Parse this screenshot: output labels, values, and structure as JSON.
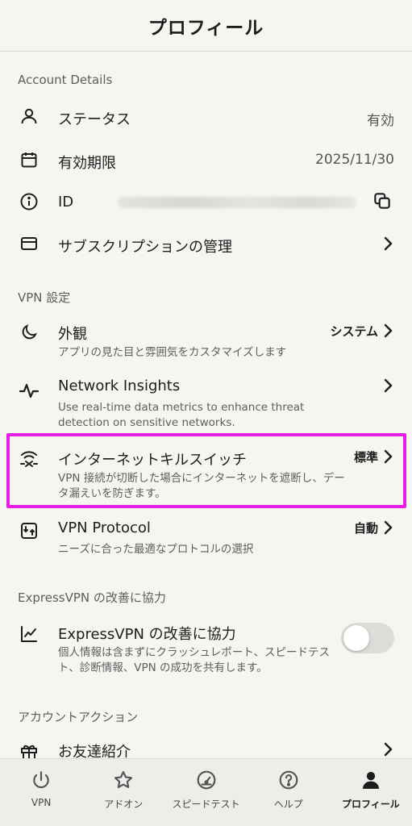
{
  "header": {
    "title": "プロフィール"
  },
  "account": {
    "section_title": "Account Details",
    "status_label": "ステータス",
    "status_value": "有効",
    "expiry_label": "有効期限",
    "expiry_value": "2025/11/30",
    "id_label": "ID",
    "subscription_label": "サブスクリプションの管理"
  },
  "vpn": {
    "section_title": "VPN 設定",
    "appearance_label": "外観",
    "appearance_desc": "アプリの見た目と雰囲気をカスタマイズします",
    "appearance_value": "システム",
    "insights_label": "Network Insights",
    "insights_desc": "Use real-time data metrics to enhance threat detection on sensitive networks.",
    "killswitch_label": "インターネットキルスイッチ",
    "killswitch_desc": "VPN 接続が切断した場合にインターネットを遮断し、データ漏えいを防ぎます。",
    "killswitch_value": "標準",
    "protocol_label": "VPN Protocol",
    "protocol_desc": "ニーズに合った最適なプロトコルの選択",
    "protocol_value": "自動"
  },
  "improve": {
    "section_title": "ExpressVPN の改善に協力",
    "label": "ExpressVPN の改善に協力",
    "desc": "個人情報は含まずにクラッシュレポート、スピードテスト、診断情報、VPN の成功を共有します。",
    "toggle_on": false
  },
  "actions": {
    "section_title": "アカウントアクション",
    "referral_label": "お友達紹介"
  },
  "tabs": [
    {
      "label": "VPN",
      "icon": "power-icon"
    },
    {
      "label": "アドオン",
      "icon": "star-icon"
    },
    {
      "label": "スピードテスト",
      "icon": "speedometer-icon"
    },
    {
      "label": "ヘルプ",
      "icon": "help-icon"
    },
    {
      "label": "プロフィール",
      "icon": "person-icon",
      "active": true
    }
  ],
  "colors": {
    "highlight": "#e81ee8",
    "background": "#f6f5f1"
  }
}
